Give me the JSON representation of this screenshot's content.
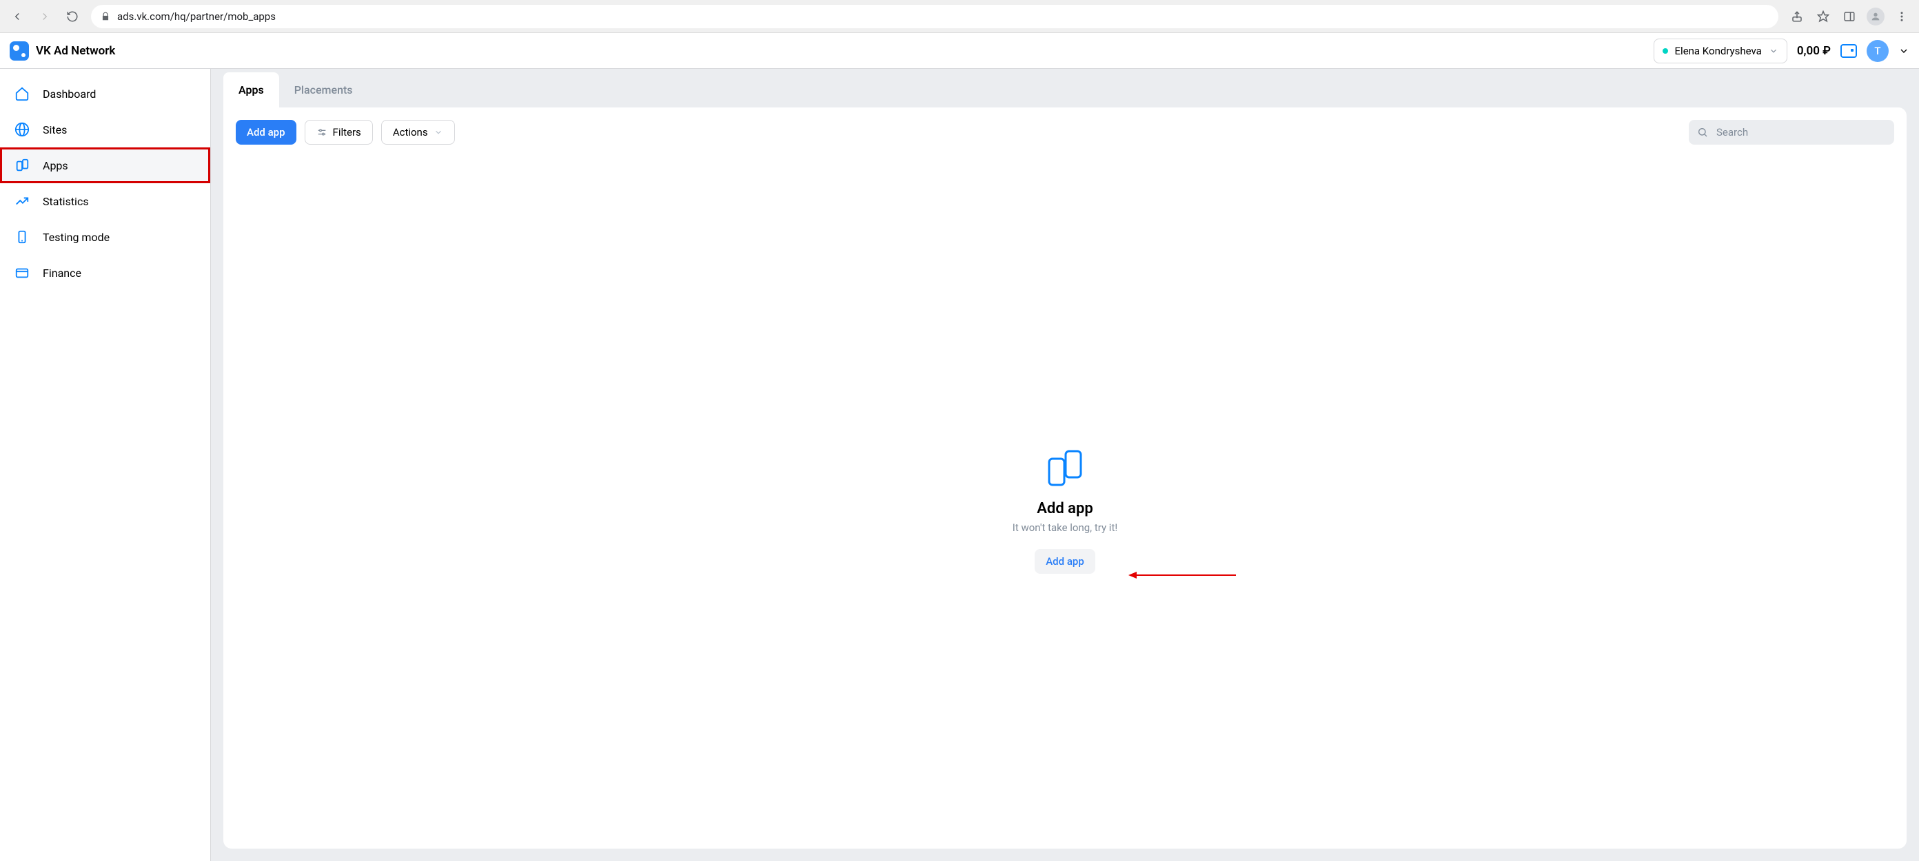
{
  "browser": {
    "url": "ads.vk.com/hq/partner/mob_apps"
  },
  "header": {
    "brand": "VK Ad Network",
    "account_name": "Elena Kondrysheva",
    "balance": "0,00 ₽",
    "avatar_letter": "T"
  },
  "sidebar": {
    "items": [
      {
        "label": "Dashboard"
      },
      {
        "label": "Sites"
      },
      {
        "label": "Apps"
      },
      {
        "label": "Statistics"
      },
      {
        "label": "Testing mode"
      },
      {
        "label": "Finance"
      }
    ]
  },
  "tabs": {
    "items": [
      {
        "label": "Apps"
      },
      {
        "label": "Placements"
      }
    ]
  },
  "toolbar": {
    "add_label": "Add app",
    "filters_label": "Filters",
    "actions_label": "Actions",
    "search_placeholder": "Search"
  },
  "empty": {
    "title": "Add app",
    "subtitle": "It won't take long, try it!",
    "cta": "Add app"
  }
}
